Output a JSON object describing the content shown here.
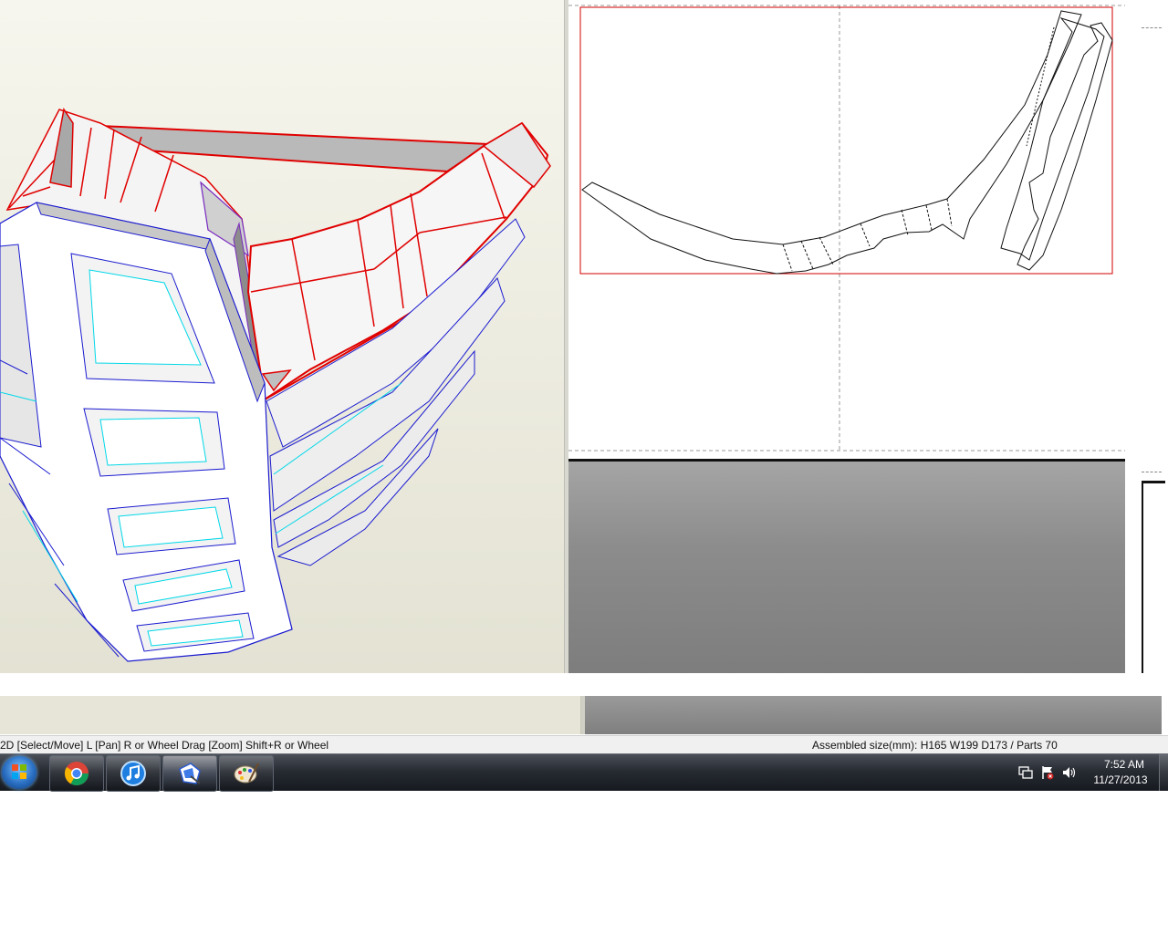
{
  "views": {
    "view3d_label": "3D model view",
    "view2d_label": "2D unfolded pattern view"
  },
  "status": {
    "left": "2D [Select/Move] L [Pan] R or Wheel Drag [Zoom] Shift+R or Wheel",
    "right": "Assembled size(mm): H165 W199 D173 / Parts 70"
  },
  "taskbar": {
    "apps": [
      {
        "name": "Google Chrome",
        "icon": "chrome-icon"
      },
      {
        "name": "iTunes",
        "icon": "itunes-icon"
      },
      {
        "name": "Pepakura Designer",
        "icon": "pepakura-icon",
        "active": true
      },
      {
        "name": "Paint",
        "icon": "paint-icon"
      }
    ],
    "tray_icons": [
      "network-icon",
      "action-center-icon",
      "volume-icon"
    ],
    "clock": {
      "time": "7:52 AM",
      "date": "11/27/2013"
    }
  },
  "colors": {
    "selected_edge": "#e00000",
    "model_edge": "#1a1ad0",
    "fold_edge": "#00d8e8",
    "taskbar": "#1f232a"
  }
}
